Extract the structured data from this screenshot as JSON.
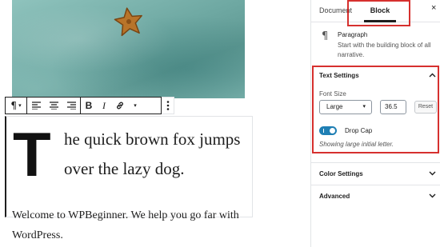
{
  "editor": {
    "toolbar": {
      "paragraph_icon": "¶",
      "bold_label": "B",
      "italic_label": "I"
    },
    "paragraph": {
      "drop_cap_letter": "T",
      "text_rest": "he quick brown fox jumps over the lazy dog."
    },
    "welcome": "Welcome to WPBeginner. We help you go far with WordPress."
  },
  "sidebar": {
    "tabs": [
      {
        "label": "Document"
      },
      {
        "label": "Block"
      }
    ],
    "close_icon": "×",
    "block_card": {
      "icon": "¶",
      "title": "Paragraph",
      "description": "Start with the building block of all narrative."
    },
    "text_settings": {
      "title": "Text Settings",
      "font_size_label": "Font Size",
      "font_size_selected": "Large",
      "font_size_value": "36.5",
      "reset_label": "Reset",
      "drop_cap_label": "Drop Cap",
      "drop_cap_enabled": true,
      "drop_cap_help": "Showing large initial letter."
    },
    "color_settings": {
      "title": "Color Settings"
    },
    "advanced": {
      "title": "Advanced"
    }
  },
  "colors": {
    "highlight": "#d6302e",
    "toggle_on": "#1f7fb4"
  }
}
